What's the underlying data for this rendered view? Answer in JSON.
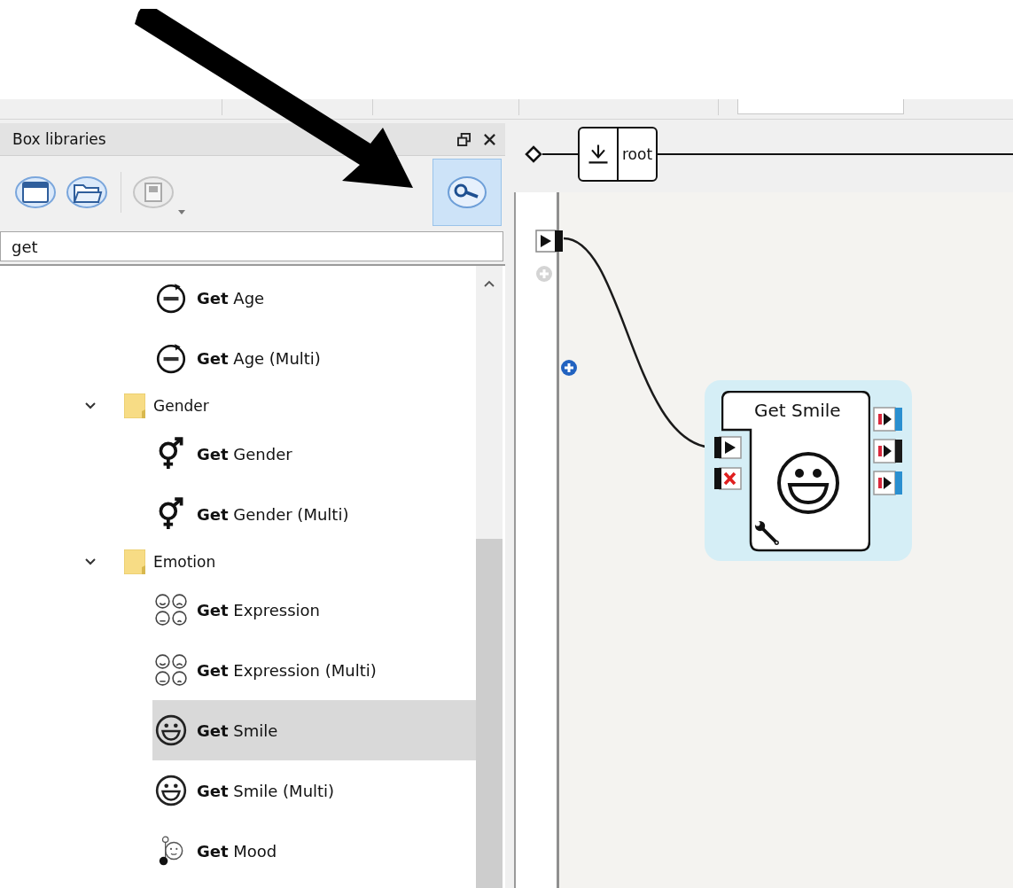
{
  "panel": {
    "title": "Box libraries",
    "library_buttons": [
      {
        "kind": "new",
        "disabled": false
      },
      {
        "kind": "open",
        "disabled": false
      },
      {
        "kind": "save",
        "disabled": true
      }
    ],
    "filter_toggle": {
      "on": true
    },
    "search": {
      "value": "get"
    },
    "tree": [
      {
        "kind": "continued",
        "children": [
          {
            "kind": "age",
            "label": "**Get** Age",
            "selected": false
          },
          {
            "kind": "age",
            "label": "**Get** Age (Multi)",
            "selected": false
          }
        ]
      },
      {
        "kind": "folder",
        "label": "Gender",
        "expanded": true,
        "children": [
          {
            "kind": "gender",
            "label": "**Get** Gender",
            "selected": false
          },
          {
            "kind": "gender",
            "label": "**Get** Gender (Multi)",
            "selected": false
          }
        ]
      },
      {
        "kind": "folder",
        "label": "Emotion",
        "expanded": true,
        "children": [
          {
            "kind": "expression",
            "label": "**Get** Expression",
            "selected": false
          },
          {
            "kind": "expression",
            "label": "**Get** Expression (Multi)",
            "selected": false
          },
          {
            "kind": "smile",
            "label": "**Get** Smile",
            "selected": true
          },
          {
            "kind": "smile",
            "label": "**Get** Smile (Multi)",
            "selected": false
          },
          {
            "kind": "mood",
            "label": "**Get** Mood",
            "selected": false
          }
        ]
      }
    ]
  },
  "diagram": {
    "root_box": {
      "label": "root"
    },
    "node": {
      "title": "Get Smile",
      "selected": true,
      "inputs": [
        {
          "kind": "start"
        },
        {
          "kind": "stop"
        }
      ],
      "outputs": [
        {
          "color": "#2a8fd0"
        },
        {
          "color": "#1a1a1a"
        },
        {
          "color": "#2a8fd0"
        }
      ]
    }
  }
}
